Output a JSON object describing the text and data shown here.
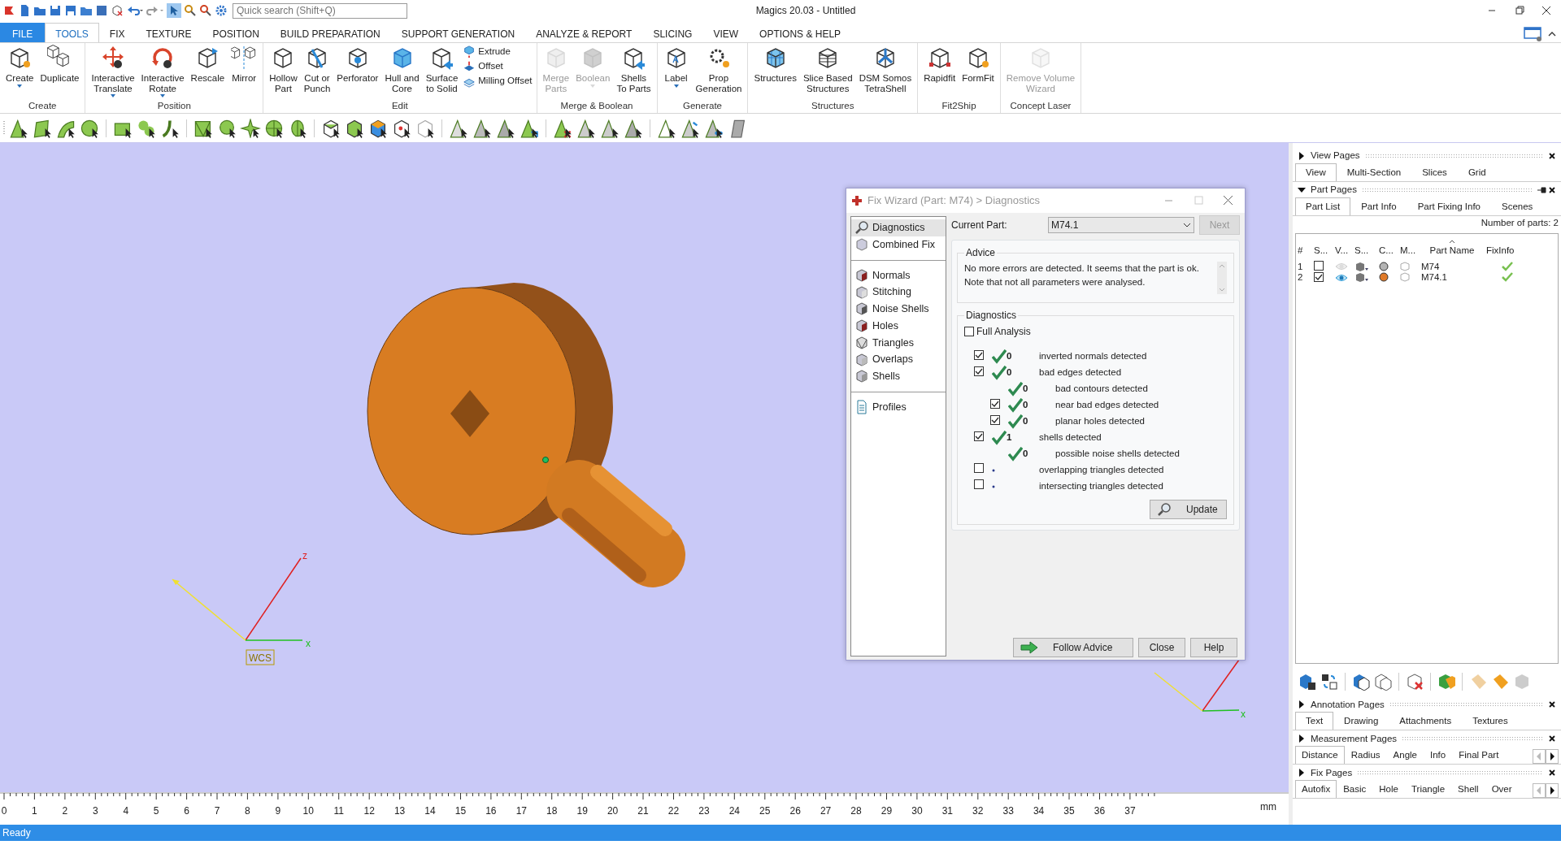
{
  "title_bar": {
    "search_placeholder": "Quick search (Shift+Q)",
    "title": "Magics 20.03 - Untitled"
  },
  "ribbon_tabs": [
    {
      "label": "FILE",
      "kind": "file",
      "selected": false
    },
    {
      "label": "TOOLS",
      "kind": "tab",
      "selected": true
    },
    {
      "label": "FIX",
      "kind": "tab",
      "selected": false
    },
    {
      "label": "TEXTURE",
      "kind": "tab",
      "selected": false
    },
    {
      "label": "POSITION",
      "kind": "tab",
      "selected": false
    },
    {
      "label": "BUILD PREPARATION",
      "kind": "tab",
      "selected": false
    },
    {
      "label": "SUPPORT GENERATION",
      "kind": "tab",
      "selected": false
    },
    {
      "label": "ANALYZE & REPORT",
      "kind": "tab",
      "selected": false
    },
    {
      "label": "SLICING",
      "kind": "tab",
      "selected": false
    },
    {
      "label": "VIEW",
      "kind": "tab",
      "selected": false
    },
    {
      "label": "OPTIONS & HELP",
      "kind": "tab",
      "selected": false
    }
  ],
  "ribbon_groups": [
    {
      "label": "Create",
      "buttons": [
        {
          "label": "Create",
          "kind": "large",
          "dropdown": true,
          "disabled": false
        },
        {
          "label": "Duplicate",
          "kind": "large",
          "dropdown": false,
          "disabled": false
        }
      ]
    },
    {
      "label": "Position",
      "buttons": [
        {
          "label": "Interactive\nTranslate",
          "kind": "large",
          "dropdown": true,
          "disabled": false
        },
        {
          "label": "Interactive\nRotate",
          "kind": "large",
          "dropdown": true,
          "disabled": false
        },
        {
          "label": "Rescale",
          "kind": "large",
          "dropdown": false,
          "disabled": false
        },
        {
          "label": "Mirror",
          "kind": "large",
          "dropdown": false,
          "disabled": false
        }
      ]
    },
    {
      "label": "Edit",
      "buttons": [
        {
          "label": "Hollow\nPart",
          "kind": "large",
          "dropdown": false,
          "disabled": false
        },
        {
          "label": "Cut or\nPunch",
          "kind": "large",
          "dropdown": false,
          "disabled": false
        },
        {
          "label": "Perforator",
          "kind": "large",
          "dropdown": false,
          "disabled": false
        },
        {
          "label": "Hull and\nCore",
          "kind": "large",
          "dropdown": false,
          "disabled": false
        },
        {
          "label": "Surface\nto Solid",
          "kind": "large",
          "dropdown": false,
          "disabled": false
        },
        {
          "label": "Extrude",
          "kind": "small",
          "dropdown": false,
          "disabled": false
        },
        {
          "label": "Offset",
          "kind": "small",
          "dropdown": false,
          "disabled": false
        },
        {
          "label": "Milling Offset",
          "kind": "small",
          "dropdown": false,
          "disabled": false
        }
      ]
    },
    {
      "label": "Merge & Boolean",
      "buttons": [
        {
          "label": "Merge\nParts",
          "kind": "large",
          "dropdown": false,
          "disabled": true
        },
        {
          "label": "Boolean",
          "kind": "large",
          "dropdown": true,
          "disabled": true
        },
        {
          "label": "Shells\nTo Parts",
          "kind": "large",
          "dropdown": false,
          "disabled": false
        }
      ]
    },
    {
      "label": "Generate",
      "buttons": [
        {
          "label": "Label",
          "kind": "large",
          "dropdown": true,
          "disabled": false
        },
        {
          "label": "Prop\nGeneration",
          "kind": "large",
          "dropdown": false,
          "disabled": false
        }
      ]
    },
    {
      "label": "Structures",
      "buttons": [
        {
          "label": "Structures",
          "kind": "large",
          "dropdown": false,
          "disabled": false
        },
        {
          "label": "Slice Based\nStructures",
          "kind": "large",
          "dropdown": false,
          "disabled": false
        },
        {
          "label": "DSM Somos\nTetraShell",
          "kind": "large",
          "dropdown": false,
          "disabled": false
        }
      ]
    },
    {
      "label": "Fit2Ship",
      "buttons": [
        {
          "label": "Rapidfit",
          "kind": "large",
          "dropdown": false,
          "disabled": false
        },
        {
          "label": "FormFit",
          "kind": "large",
          "dropdown": false,
          "disabled": false
        }
      ]
    },
    {
      "label": "Concept Laser",
      "buttons": [
        {
          "label": "Remove Volume\nWizard",
          "kind": "large",
          "dropdown": false,
          "disabled": true
        }
      ]
    }
  ],
  "viewport": {
    "z_label": "z",
    "x_label": "x",
    "wcs_label": "WCS",
    "corner_x_label": "x"
  },
  "fix_wizard": {
    "title": "Fix Wizard (Part: M74) > Diagnostics",
    "nav_groups": [
      {
        "items": [
          {
            "label": "Diagnostics",
            "selected": true
          },
          {
            "label": "Combined Fix",
            "selected": false
          }
        ]
      },
      {
        "items": [
          {
            "label": "Normals",
            "selected": false
          },
          {
            "label": "Stitching",
            "selected": false
          },
          {
            "label": "Noise Shells",
            "selected": false
          },
          {
            "label": "Holes",
            "selected": false
          },
          {
            "label": "Triangles",
            "selected": false
          },
          {
            "label": "Overlaps",
            "selected": false
          },
          {
            "label": "Shells",
            "selected": false
          }
        ]
      },
      {
        "items": [
          {
            "label": "Profiles",
            "selected": false
          }
        ]
      }
    ],
    "current_part": {
      "label": "Current Part:",
      "value": "M74.1"
    },
    "next_button": {
      "label": "Next",
      "disabled": true
    },
    "advice": {
      "title": "Advice",
      "text": "No more errors are detected. It seems that the part is ok.\nNote that not all parameters were analysed."
    },
    "diagnostics": {
      "title": "Diagnostics",
      "full_analysis": {
        "label": "Full Analysis",
        "checked": false
      },
      "rows": [
        {
          "kind": "check",
          "checked": true,
          "passed": true,
          "count": "0",
          "label": "inverted normals detected"
        },
        {
          "kind": "check",
          "checked": true,
          "passed": true,
          "count": "0",
          "label": "bad edges detected",
          "children": [
            {
              "kind": "plain",
              "passed": true,
              "count": "0",
              "label": "bad contours detected"
            },
            {
              "kind": "check",
              "checked": true,
              "passed": true,
              "count": "0",
              "label": "near bad edges detected"
            },
            {
              "kind": "check",
              "checked": true,
              "passed": true,
              "count": "0",
              "label": "planar holes detected"
            }
          ]
        },
        {
          "kind": "check",
          "checked": true,
          "passed": true,
          "count": "1",
          "label": "shells detected",
          "children": [
            {
              "kind": "plain",
              "passed": true,
              "count": "0",
              "label": "possible noise shells detected"
            }
          ]
        },
        {
          "kind": "check",
          "checked": false,
          "passed": false,
          "label": "overlapping triangles detected"
        },
        {
          "kind": "check",
          "checked": false,
          "passed": false,
          "label": "intersecting triangles detected"
        }
      ],
      "update_button": "Update"
    },
    "buttons": [
      {
        "label": "Follow Advice",
        "kind": "follow"
      },
      {
        "label": "Close",
        "kind": "plain"
      },
      {
        "label": "Help",
        "kind": "plain"
      }
    ]
  },
  "ruler": {
    "ticks": [
      "0",
      "1",
      "2",
      "3",
      "4",
      "5",
      "6",
      "7",
      "8",
      "9",
      "10",
      "11",
      "12",
      "13",
      "14",
      "15",
      "16",
      "17",
      "18",
      "19",
      "20",
      "21",
      "22",
      "23",
      "24",
      "25",
      "26",
      "27",
      "28",
      "29",
      "30",
      "31",
      "32",
      "33",
      "34",
      "35",
      "36",
      "37"
    ],
    "unit": "mm"
  },
  "view_pages": {
    "title": "View Pages",
    "expanded": false,
    "tabs": [
      {
        "label": "View",
        "selected": true
      },
      {
        "label": "Multi-Section",
        "selected": false
      },
      {
        "label": "Slices",
        "selected": false
      },
      {
        "label": "Grid",
        "selected": false
      }
    ]
  },
  "part_pages": {
    "title": "Part Pages",
    "expanded": true,
    "tabs": [
      {
        "label": "Part List",
        "selected": true
      },
      {
        "label": "Part Info",
        "selected": false
      },
      {
        "label": "Part Fixing Info",
        "selected": false
      },
      {
        "label": "Scenes",
        "selected": false
      }
    ],
    "parts_count": "Number of parts: 2",
    "columns": [
      "#",
      "S...",
      "V...",
      "S...",
      "C...",
      "M...",
      "Part Name",
      "FixInfo"
    ],
    "parts": [
      {
        "number": "1",
        "selected": false,
        "visible": false,
        "color": "#b4b4b4",
        "name": "M74",
        "fix_ok": true
      },
      {
        "number": "2",
        "selected": true,
        "visible": true,
        "color": "#e07a28",
        "name": "M74.1",
        "fix_ok": true
      }
    ]
  },
  "annotation_pages": {
    "title": "Annotation Pages",
    "expanded": false,
    "tabs": [
      {
        "label": "Text",
        "selected": true
      },
      {
        "label": "Drawing",
        "selected": false
      },
      {
        "label": "Attachments",
        "selected": false
      },
      {
        "label": "Textures",
        "selected": false
      }
    ]
  },
  "measurement_pages": {
    "title": "Measurement Pages",
    "expanded": false,
    "tabs": [
      {
        "label": "Distance",
        "selected": true
      },
      {
        "label": "Radius",
        "selected": false
      },
      {
        "label": "Angle",
        "selected": false
      },
      {
        "label": "Info",
        "selected": false
      },
      {
        "label": "Final Part",
        "selected": false
      }
    ]
  },
  "fix_pages": {
    "title": "Fix Pages",
    "expanded": false,
    "tabs": [
      {
        "label": "Autofix",
        "selected": true
      },
      {
        "label": "Basic",
        "selected": false
      },
      {
        "label": "Hole",
        "selected": false
      },
      {
        "label": "Triangle",
        "selected": false
      },
      {
        "label": "Shell",
        "selected": false
      },
      {
        "label": "Over",
        "selected": false
      }
    ]
  },
  "status_bar": {
    "text": "Ready"
  }
}
